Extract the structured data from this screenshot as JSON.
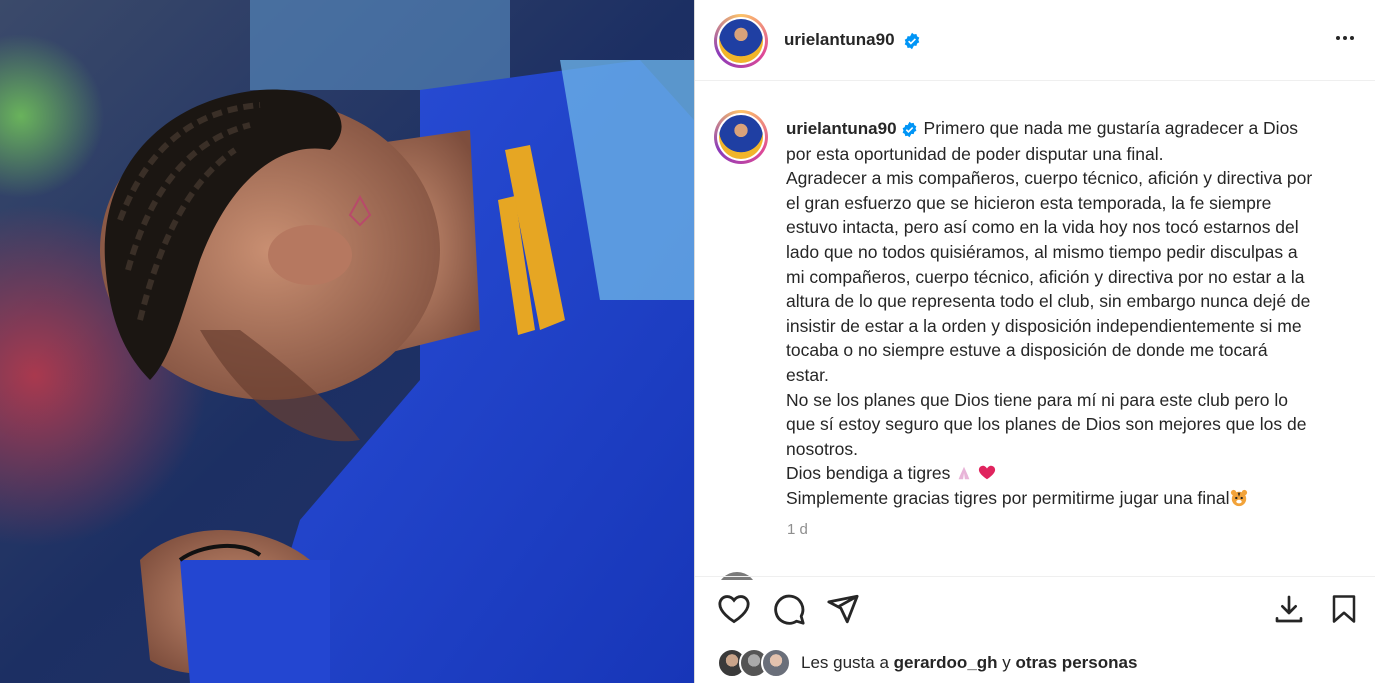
{
  "post": {
    "username": "urielantuna90",
    "caption_lines": [
      "Primero que nada me gustaría agradecer a Dios",
      "por esta oportunidad de poder disputar una final.",
      "Agradecer a mis compañeros, cuerpo técnico, afición y directiva por",
      "el gran esfuerzo que se hicieron esta temporada, la fe siempre",
      "estuvo intacta, pero así como en la vida hoy nos tocó estarnos del",
      "lado que no todos quisiéramos, al mismo tiempo pedir disculpas a",
      "mi compañeros, cuerpo técnico, afición y directiva por no estar a la",
      "altura de lo que representa todo el club, sin embargo nunca dejé de",
      "insistir de estar a la orden y disposición independientemente si me",
      "tocaba o no siempre estuve a disposición de donde me tocará",
      "estar.",
      "No se los planes que Dios tiene para mí ni para este club pero lo",
      "que sí estoy seguro que los planes de Dios son mejores que los de",
      "nosotros.",
      "Dios bendiga a tigres",
      "Simplemente gracias tigres por permitirme jugar una final"
    ],
    "time": "1 d"
  },
  "likes": {
    "prefix": "Les gusta a",
    "user": "gerardoo_gh",
    "joiner": "y",
    "others": "otras personas"
  },
  "icons": {
    "like": "heart-icon",
    "comment": "comment-icon",
    "share": "send-icon",
    "download": "download-icon",
    "save": "bookmark-icon",
    "more": "more-options-icon",
    "verified": "verified-badge-icon"
  },
  "colors": {
    "verified": "#0095f6",
    "text": "#262626",
    "muted": "#8e8e8e"
  }
}
